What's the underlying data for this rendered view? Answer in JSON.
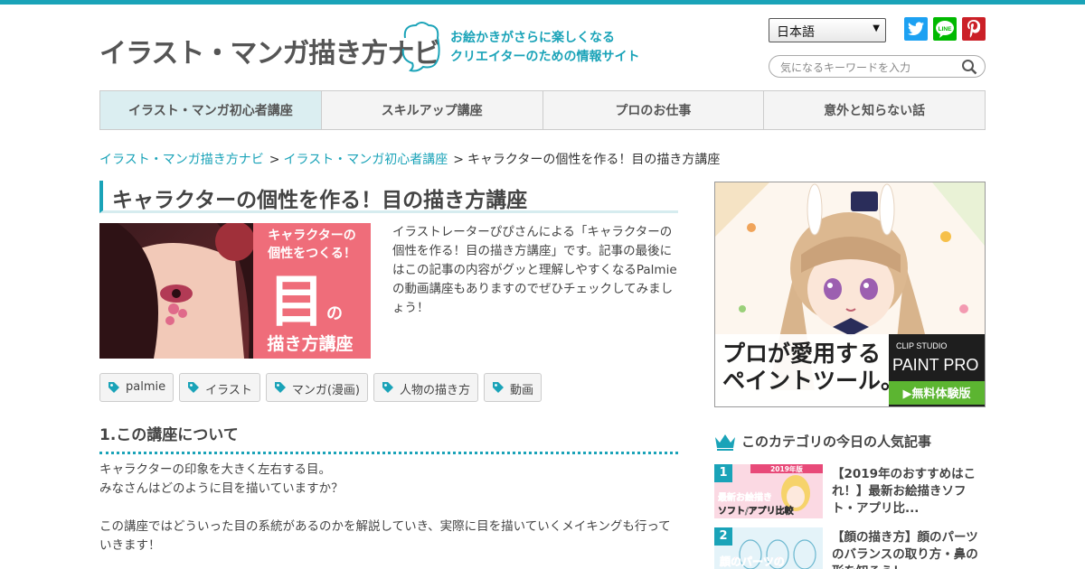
{
  "header": {
    "logo_text": "イラスト・マンガ描き方ナビ",
    "tagline_line1": "お絵かきがさらに楽しくなる",
    "tagline_line2": "クリエイターのための情報サイト",
    "language": "日本語",
    "search_placeholder": "気になるキーワードを入力",
    "social_icons": [
      "twitter-icon",
      "line-icon",
      "pinterest-icon"
    ],
    "line_label": "LINE"
  },
  "nav": {
    "items": [
      {
        "label": "イラスト・マンガ初心者講座"
      },
      {
        "label": "スキルアップ講座"
      },
      {
        "label": "プロのお仕事"
      },
      {
        "label": "意外と知らない話"
      }
    ]
  },
  "breadcrumb": {
    "items": [
      "イラスト・マンガ描き方ナビ",
      "イラスト・マンガ初心者講座"
    ],
    "current": "キャラクターの個性を作る！目の描き方講座",
    "separator": ">"
  },
  "article": {
    "title": "キャラクターの個性を作る！目の描き方講座",
    "thumb": {
      "line1": "キャラクターの",
      "line2": "個性をつくる！",
      "big": "目",
      "small": "の",
      "line3": "描き方講座"
    },
    "intro": "イラストレーターぴぴさんによる「キャラクターの個性を作る！目の描き方講座」です。記事の最後にはこの記事の内容がグッと理解しやすくなるPalmieの動画講座もありますのでぜひチェックしてみましょう！",
    "tags": [
      "palmie",
      "イラスト",
      "マンガ(漫画)",
      "人物の描き方",
      "動画"
    ],
    "section_title": "1.この講座について",
    "body_line1": "キャラクターの印象を大きく左右する目。",
    "body_line2": "みなさんはどのように目を描いていますか？",
    "body_line3": "この講座ではどういった目の系統があるのかを解説していき、実際に目を描いていくメイキングも行っていきます！"
  },
  "sidebar": {
    "ad": {
      "line1": "プロが愛用する",
      "line2": "ペイントツール。",
      "brand_small": "CLIP STUDIO",
      "brand_big": "PAINT PRO",
      "cta": "▶無料体験版"
    },
    "popular_title": "このカテゴリの今日の人気記事",
    "popular": [
      {
        "rank": "1",
        "text": "【2019年のおすすめはこれ！】最新お絵描きソフト・アプリ比...",
        "thumb_line1": "2019年版",
        "thumb_line2": "最新お絵描き",
        "thumb_line3": "ソフト/アプリ比較"
      },
      {
        "rank": "2",
        "text": "【顔の描き方】顔のパーツのバランスの取り方・鼻の形を知ろう！",
        "thumb_line1": "顔のパーツの"
      }
    ]
  },
  "colors": {
    "accent": "#1aa3b8",
    "twitter": "#1da1f2",
    "line": "#00b900",
    "pinterest": "#cb2027",
    "ad_green": "#5cb531"
  }
}
